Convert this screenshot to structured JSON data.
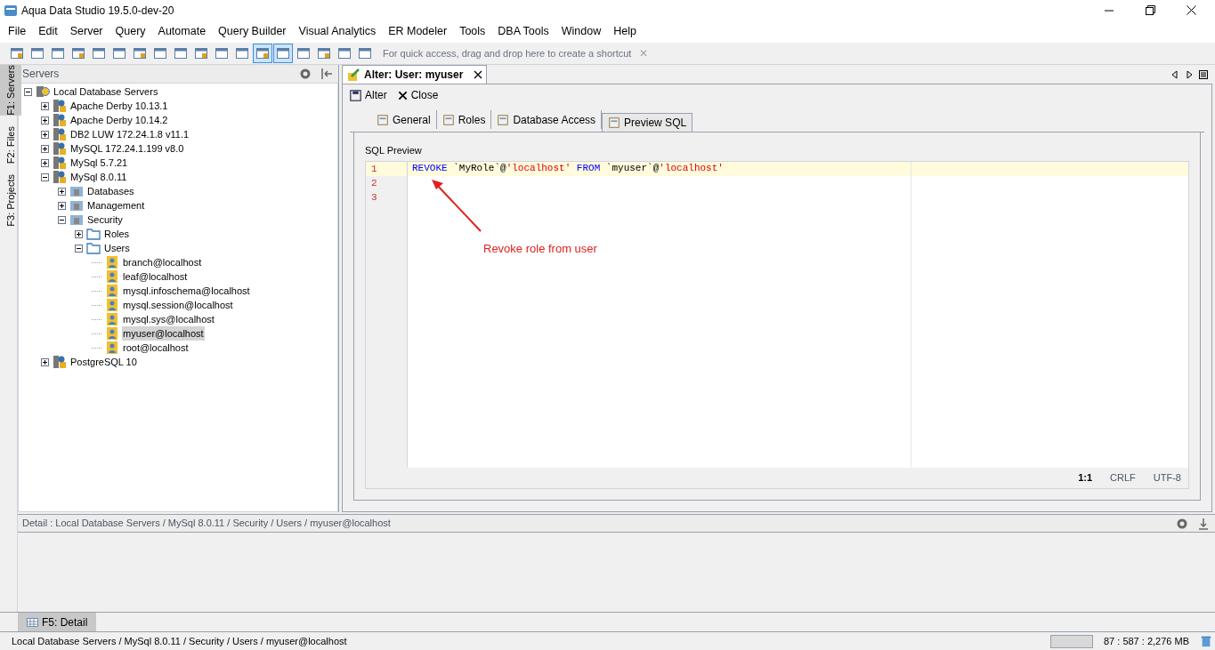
{
  "window": {
    "title": "Aqua Data Studio 19.5.0-dev-20"
  },
  "menu": [
    "File",
    "Edit",
    "Server",
    "Query",
    "Automate",
    "Query Builder",
    "Visual Analytics",
    "ER Modeler",
    "Tools",
    "DBA Tools",
    "Window",
    "Help"
  ],
  "toolbar": {
    "icons": [
      {
        "pressed": false
      },
      {
        "pressed": false
      },
      {
        "pressed": false
      },
      {
        "pressed": false
      },
      {
        "pressed": false
      },
      {
        "pressed": false
      },
      {
        "pressed": false
      },
      {
        "pressed": false
      },
      {
        "pressed": false
      },
      {
        "pressed": false
      },
      {
        "pressed": false
      },
      {
        "pressed": false
      },
      {
        "pressed": true
      },
      {
        "pressed": true
      },
      {
        "pressed": false
      },
      {
        "pressed": false
      },
      {
        "pressed": false
      },
      {
        "pressed": false
      }
    ],
    "shortcut_hint": "For quick access, drag and drop here to create a shortcut",
    "close": "✕"
  },
  "side_tabs": [
    {
      "label": "F1: Servers",
      "selected": true
    },
    {
      "label": "F2: Files",
      "selected": false
    },
    {
      "label": "F3: Projects",
      "selected": false
    }
  ],
  "servers_panel": {
    "title": "Servers",
    "tree": [
      {
        "label": "Local Database Servers",
        "kind": "root",
        "expanded": true,
        "selected": false,
        "children": [
          {
            "label": "Apache Derby 10.13.1",
            "kind": "server",
            "expanded": false,
            "selected": false
          },
          {
            "label": "Apache Derby 10.14.2",
            "kind": "server",
            "expanded": false,
            "selected": false
          },
          {
            "label": "DB2 LUW 172.24.1.8 v11.1",
            "kind": "server",
            "expanded": false,
            "selected": false
          },
          {
            "label": "MySQL 172.24.1.199 v8.0",
            "kind": "server",
            "expanded": false,
            "selected": false
          },
          {
            "label": "MySql 5.7.21",
            "kind": "server",
            "expanded": false,
            "selected": false
          },
          {
            "label": "MySql 8.0.11",
            "kind": "server",
            "expanded": true,
            "selected": false,
            "children": [
              {
                "label": "Databases",
                "kind": "category",
                "expanded": false,
                "selected": false
              },
              {
                "label": "Management",
                "kind": "category",
                "expanded": false,
                "selected": false
              },
              {
                "label": "Security",
                "kind": "category",
                "expanded": true,
                "selected": false,
                "children": [
                  {
                    "label": "Roles",
                    "kind": "folder",
                    "expanded": false,
                    "selected": false
                  },
                  {
                    "label": "Users",
                    "kind": "folder",
                    "expanded": true,
                    "selected": false,
                    "children": [
                      {
                        "label": "branch@localhost",
                        "kind": "user",
                        "selected": false
                      },
                      {
                        "label": "leaf@localhost",
                        "kind": "user",
                        "selected": false
                      },
                      {
                        "label": "mysql.infoschema@localhost",
                        "kind": "user",
                        "selected": false
                      },
                      {
                        "label": "mysql.session@localhost",
                        "kind": "user",
                        "selected": false
                      },
                      {
                        "label": "mysql.sys@localhost",
                        "kind": "user",
                        "selected": false
                      },
                      {
                        "label": "myuser@localhost",
                        "kind": "user",
                        "selected": true
                      },
                      {
                        "label": "root@localhost",
                        "kind": "user",
                        "selected": false
                      }
                    ]
                  }
                ]
              }
            ]
          },
          {
            "label": "PostgreSQL 10",
            "kind": "server",
            "expanded": false,
            "selected": false
          }
        ]
      }
    ]
  },
  "editor": {
    "tab": "Alter: User: myuser",
    "actions": [
      {
        "label": "Alter",
        "kind": "save"
      },
      {
        "label": "Close",
        "kind": "close"
      }
    ],
    "tabs": [
      {
        "label": "General",
        "selected": false
      },
      {
        "label": "Roles",
        "selected": false
      },
      {
        "label": "Database Access",
        "selected": false
      },
      {
        "label": "Preview SQL",
        "selected": true
      }
    ],
    "section_title": "SQL Preview",
    "lines": [
      {
        "number": "1",
        "current": true,
        "tokens": [
          {
            "text": "REVOKE",
            "kind": "keyword"
          },
          {
            "text": " `MyRole`@",
            "kind": "plain"
          },
          {
            "text": "'localhost'",
            "kind": "string"
          },
          {
            "text": " FROM",
            "kind": "keyword"
          },
          {
            "text": " `myuser`@",
            "kind": "plain"
          },
          {
            "text": "'localhost'",
            "kind": "string"
          }
        ]
      },
      {
        "number": "2",
        "current": false
      },
      {
        "number": "3",
        "current": false
      }
    ],
    "annotation": "Revoke role from user",
    "status": [
      "1:1",
      "CRLF",
      "UTF-8"
    ]
  },
  "detail": {
    "title": "Detail : Local Database Servers / MySql 8.0.11 / Security / Users / myuser@localhost",
    "tab": "F5: Detail"
  },
  "status_bar": {
    "path": "Local Database Servers / MySql 8.0.11 / Security / Users / myuser@localhost",
    "memory": "87 : 587 : 2,276 MB"
  }
}
